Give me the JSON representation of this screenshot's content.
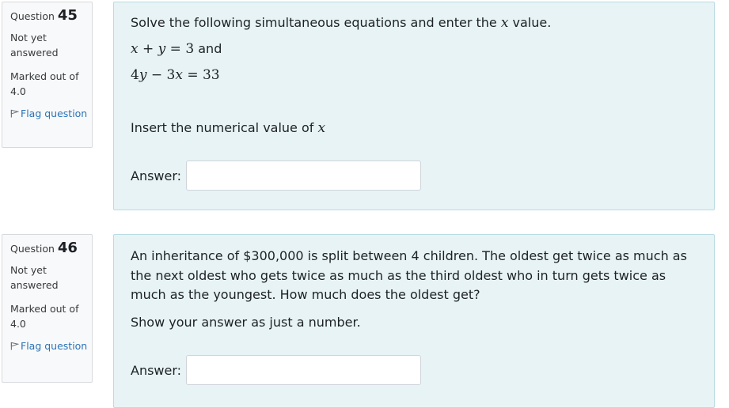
{
  "questions": [
    {
      "label": "Question",
      "number": "45",
      "state": "Not yet answered",
      "grade": "Marked out of 4.0",
      "flag_label": "Flag question",
      "text_intro": "Solve the following simultaneous equations and enter the ",
      "text_var": "x",
      "text_outro": " value.",
      "eq1_lhs_a": "x",
      "eq1_op": " + ",
      "eq1_lhs_b": "y",
      "eq1_rel": " = ",
      "eq1_rhs": "3",
      "eq1_and": " and",
      "eq2_coef_a": "4",
      "eq2_var_a": "y",
      "eq2_op": " − ",
      "eq2_coef_b": "3",
      "eq2_var_b": "x",
      "eq2_rel": " = ",
      "eq2_rhs": "33",
      "instruction": "Insert the numerical value of ",
      "instruction_var": "x",
      "answer_label": "Answer:",
      "answer_value": ""
    },
    {
      "label": "Question",
      "number": "46",
      "state": "Not yet answered",
      "grade": "Marked out of 4.0",
      "flag_label": "Flag question",
      "text": "An inheritance of $300,000 is split between 4 children.  The oldest get twice as much as the next oldest who gets twice as much as the third oldest who in turn gets twice as much as the youngest.  How much does the oldest  get?",
      "instruction": "Show your answer as just a number.",
      "answer_label": "Answer:",
      "answer_value": ""
    }
  ],
  "colors": {
    "info_bg": "#f8f9fa",
    "content_bg": "#e7f3f5",
    "link": "#2a73b6"
  }
}
